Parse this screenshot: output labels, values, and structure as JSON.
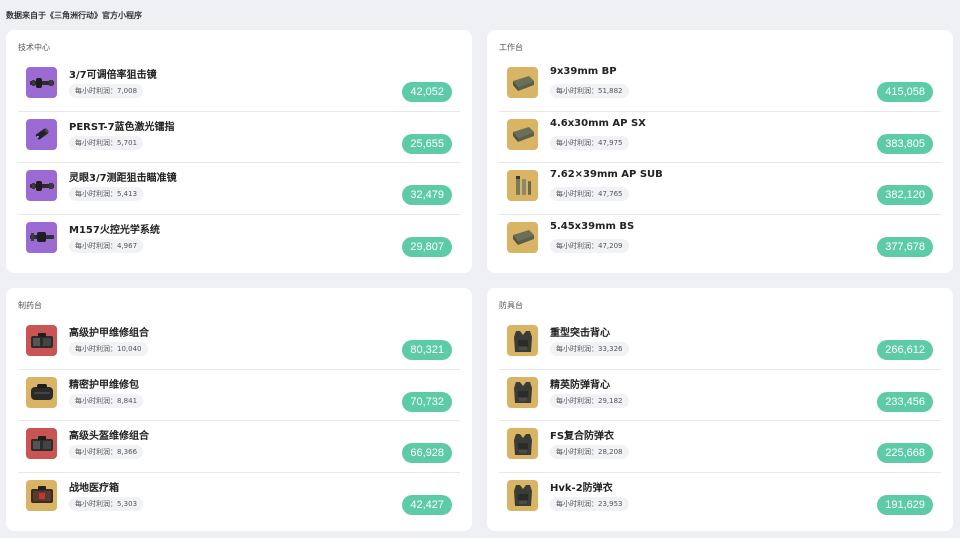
{
  "source_note": "数据来自于《三角洲行动》官方小程序",
  "profit_prefix": "每小时利润：",
  "panels": [
    {
      "title": "技术中心",
      "items": [
        {
          "name": "3/7可调倍率狙击镜",
          "hourly": "7,008",
          "value": "42,052",
          "icon": "scope-icon",
          "bg": "#9b6ad3"
        },
        {
          "name": "PERST-7蓝色激光镭指",
          "hourly": "5,701",
          "value": "25,655",
          "icon": "laser-icon",
          "bg": "#9b6ad3"
        },
        {
          "name": "灵眼3/7测距狙击瞄准镜",
          "hourly": "5,413",
          "value": "32,479",
          "icon": "scope-icon",
          "bg": "#9b6ad3"
        },
        {
          "name": "M157火控光学系统",
          "hourly": "4,967",
          "value": "29,807",
          "icon": "fire-control-icon",
          "bg": "#9b6ad3"
        }
      ]
    },
    {
      "title": "工作台",
      "items": [
        {
          "name": "9x39mm BP",
          "hourly": "51,882",
          "value": "415,058",
          "icon": "ammo-box-icon",
          "bg": "#d9b464"
        },
        {
          "name": "4.6x30mm AP SX",
          "hourly": "47,975",
          "value": "383,805",
          "icon": "ammo-box-icon",
          "bg": "#d9b464"
        },
        {
          "name": "7.62×39mm AP SUB",
          "hourly": "47,765",
          "value": "382,120",
          "icon": "ammo-rounds-icon",
          "bg": "#d9b464"
        },
        {
          "name": "5.45x39mm BS",
          "hourly": "47,209",
          "value": "377,678",
          "icon": "ammo-box-icon",
          "bg": "#d9b464"
        }
      ]
    },
    {
      "title": "制药台",
      "items": [
        {
          "name": "高级护甲维修组合",
          "hourly": "10,040",
          "value": "80,321",
          "icon": "repair-kit-icon",
          "bg": "#c95454"
        },
        {
          "name": "精密护甲维修包",
          "hourly": "8,841",
          "value": "70,732",
          "icon": "repair-bag-icon",
          "bg": "#d9b464"
        },
        {
          "name": "高级头盔维修组合",
          "hourly": "8,366",
          "value": "66,928",
          "icon": "repair-kit-icon",
          "bg": "#c95454"
        },
        {
          "name": "战地医疗箱",
          "hourly": "5,303",
          "value": "42,427",
          "icon": "medical-case-icon",
          "bg": "#d9b464"
        }
      ]
    },
    {
      "title": "防具台",
      "items": [
        {
          "name": "重型突击背心",
          "hourly": "33,326",
          "value": "266,612",
          "icon": "vest-icon",
          "bg": "#d9b464"
        },
        {
          "name": "精英防弹背心",
          "hourly": "29,182",
          "value": "233,456",
          "icon": "vest-icon",
          "bg": "#d9b464"
        },
        {
          "name": "FS复合防弹衣",
          "hourly": "28,208",
          "value": "225,668",
          "icon": "vest-icon",
          "bg": "#d9b464"
        },
        {
          "name": "Hvk-2防弹衣",
          "hourly": "23,953",
          "value": "191,629",
          "icon": "vest-icon",
          "bg": "#d9b464"
        }
      ]
    }
  ],
  "colors": {
    "value_pill": "#5ecba8",
    "page_bg": "#eef0f4"
  }
}
